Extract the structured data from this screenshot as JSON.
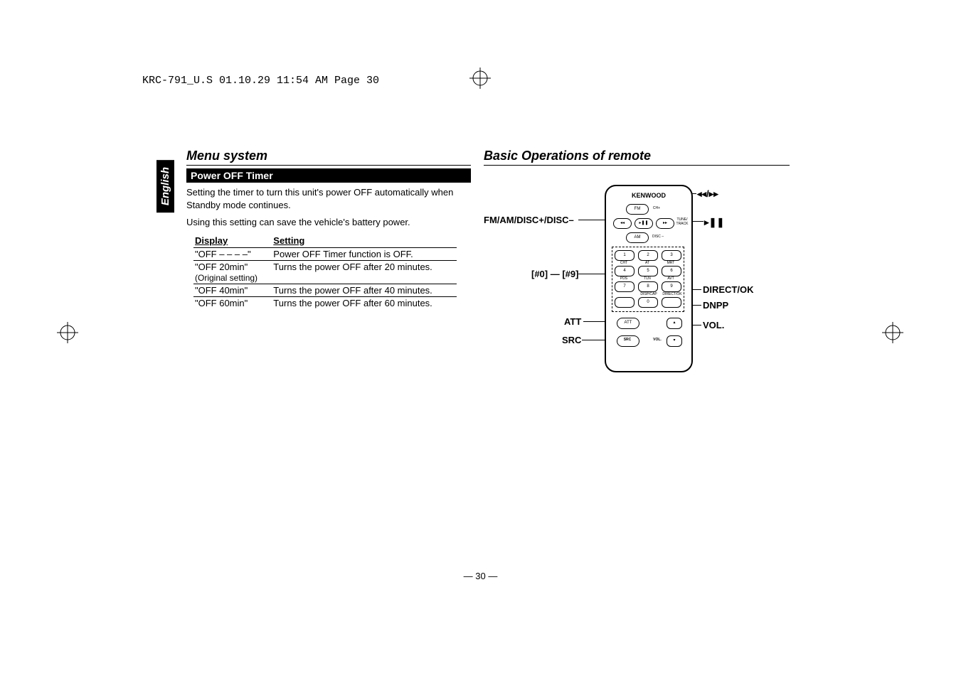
{
  "file_header": "KRC-791_U.S  01.10.29  11:54 AM  Page 30",
  "side_tab": "English",
  "left": {
    "section_title": "Menu system",
    "subhead": "Power OFF Timer",
    "para1": "Setting the timer to turn this unit's power OFF automatically when Standby mode continues.",
    "para2": "Using this setting can save the vehicle's battery power.",
    "table": {
      "col1": "Display",
      "col2": "Setting",
      "rows": [
        {
          "display": "\"OFF – – – –\"",
          "setting": "Power OFF Timer function is OFF."
        },
        {
          "display": "\"OFF 20min\"",
          "note": "(Original setting)",
          "setting": "Turns the power OFF after 20 minutes."
        },
        {
          "display": "\"OFF 40min\"",
          "setting": "Turns the power OFF after 40 minutes."
        },
        {
          "display": "\"OFF 60min\"",
          "setting": "Turns the power OFF after 60 minutes."
        }
      ]
    }
  },
  "right": {
    "section_title": "Basic Operations of remote",
    "remote_brand": "KENWOOD",
    "callouts": {
      "prev_next": "◂◂/▸▸",
      "play_pause": "▸❚❚",
      "fm_am": "FM/AM/DISC+/DISC–",
      "numpad": "[#0] — [#9]",
      "direct": "DIRECT/OK",
      "dnpp": "DNPP",
      "att": "ATT",
      "vol": "VOL.",
      "src": "SRC"
    },
    "buttons": {
      "fm": "FM",
      "ch_plus": "CH+",
      "prev": "◂◂",
      "play": "▸❚❚",
      "next": "▸▸",
      "tune_track": "TUNE/\nTRACK",
      "am": "AM",
      "disc_minus": "DISC –",
      "n1": "1",
      "n2": "2",
      "n3": "3",
      "n4": "4",
      "n5": "5",
      "n6": "6",
      "n7": "7",
      "n8": "8",
      "n9": "9",
      "n0": "0",
      "l4": "CHT",
      "l5": "AT",
      "l6": "MRT",
      "l7": "PDS",
      "l8": "TLN",
      "l9": "AVT",
      "disp": "DISP/CAP",
      "direct": "DIRECT/OK",
      "att": "ATT",
      "up": "▴",
      "down": "▾",
      "src": "SRC",
      "vol_lbl": "VOL."
    }
  },
  "page_number": "— 30 —"
}
